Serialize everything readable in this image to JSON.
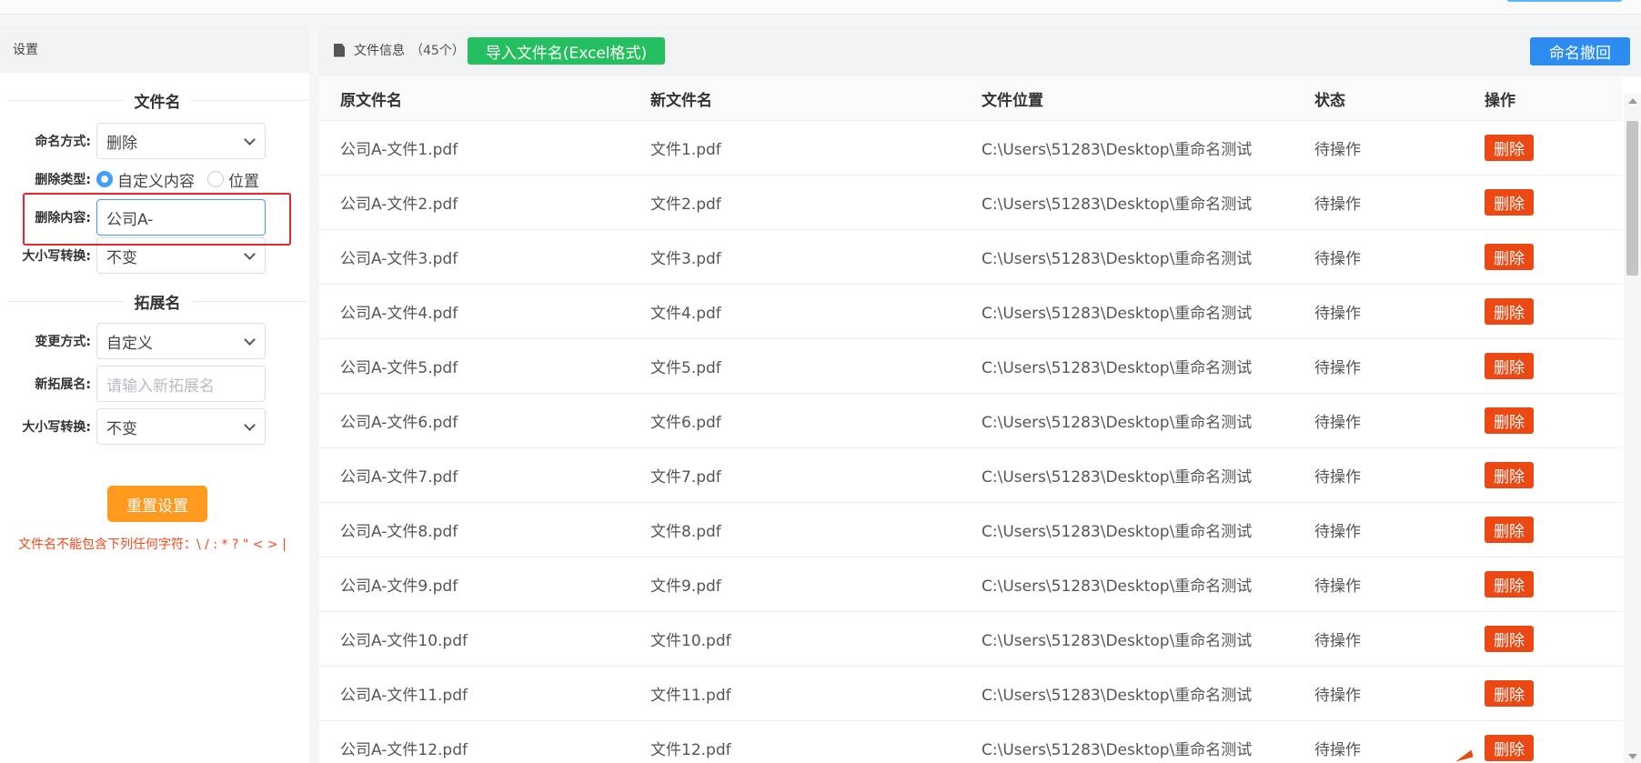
{
  "colors": {
    "accent_blue": "#409eff",
    "import_green": "#26bf5f",
    "undo_blue": "#2d8cf0",
    "reset_orange": "#ff9a1f",
    "delete_red": "#ec4813",
    "warning_red": "#f24a1d",
    "highlight_red": "#e8262b"
  },
  "left_panel": {
    "header": "设置",
    "filename_section": {
      "title": "文件名",
      "naming_method": {
        "label": "命名方式:",
        "value": "删除"
      },
      "delete_type": {
        "label": "删除类型:",
        "options": [
          {
            "label": "自定义内容",
            "checked": true
          },
          {
            "label": "位置",
            "checked": false
          }
        ]
      },
      "delete_content": {
        "label": "删除内容:",
        "value": "公司A-"
      },
      "case_convert": {
        "label": "大小写转换:",
        "value": "不变"
      }
    },
    "extension_section": {
      "title": "拓展名",
      "change_method": {
        "label": "变更方式:",
        "value": "自定义"
      },
      "new_extension": {
        "label": "新拓展名:",
        "placeholder": "请输入新拓展名"
      },
      "case_convert": {
        "label": "大小写转换:",
        "value": "不变"
      }
    },
    "reset_button": "重置设置",
    "warning": "文件名不能包含下列任何字符：\\ / : * ? \" < > |"
  },
  "right_panel": {
    "file_info_label": "文件信息",
    "file_count": "（45个）",
    "import_button": "导入文件名(Excel格式)",
    "undo_button": "命名撤回",
    "columns": [
      "原文件名",
      "新文件名",
      "文件位置",
      "状态",
      "操作"
    ],
    "rows": [
      {
        "original": "公司A-文件1.pdf",
        "new": "文件1.pdf",
        "location": "C:\\Users\\51283\\Desktop\\重命名测试",
        "status": "待操作",
        "action": "删除"
      },
      {
        "original": "公司A-文件2.pdf",
        "new": "文件2.pdf",
        "location": "C:\\Users\\51283\\Desktop\\重命名测试",
        "status": "待操作",
        "action": "删除"
      },
      {
        "original": "公司A-文件3.pdf",
        "new": "文件3.pdf",
        "location": "C:\\Users\\51283\\Desktop\\重命名测试",
        "status": "待操作",
        "action": "删除"
      },
      {
        "original": "公司A-文件4.pdf",
        "new": "文件4.pdf",
        "location": "C:\\Users\\51283\\Desktop\\重命名测试",
        "status": "待操作",
        "action": "删除"
      },
      {
        "original": "公司A-文件5.pdf",
        "new": "文件5.pdf",
        "location": "C:\\Users\\51283\\Desktop\\重命名测试",
        "status": "待操作",
        "action": "删除"
      },
      {
        "original": "公司A-文件6.pdf",
        "new": "文件6.pdf",
        "location": "C:\\Users\\51283\\Desktop\\重命名测试",
        "status": "待操作",
        "action": "删除"
      },
      {
        "original": "公司A-文件7.pdf",
        "new": "文件7.pdf",
        "location": "C:\\Users\\51283\\Desktop\\重命名测试",
        "status": "待操作",
        "action": "删除"
      },
      {
        "original": "公司A-文件8.pdf",
        "new": "文件8.pdf",
        "location": "C:\\Users\\51283\\Desktop\\重命名测试",
        "status": "待操作",
        "action": "删除"
      },
      {
        "original": "公司A-文件9.pdf",
        "new": "文件9.pdf",
        "location": "C:\\Users\\51283\\Desktop\\重命名测试",
        "status": "待操作",
        "action": "删除"
      },
      {
        "original": "公司A-文件10.pdf",
        "new": "文件10.pdf",
        "location": "C:\\Users\\51283\\Desktop\\重命名测试",
        "status": "待操作",
        "action": "删除"
      },
      {
        "original": "公司A-文件11.pdf",
        "new": "文件11.pdf",
        "location": "C:\\Users\\51283\\Desktop\\重命名测试",
        "status": "待操作",
        "action": "删除"
      },
      {
        "original": "公司A-文件12.pdf",
        "new": "文件12.pdf",
        "location": "C:\\Users\\51283\\Desktop\\重命名测试",
        "status": "待操作",
        "action": "删除"
      }
    ]
  }
}
